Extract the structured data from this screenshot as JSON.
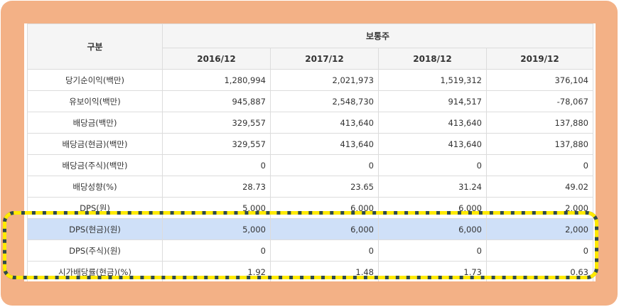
{
  "header": {
    "category_label": "구분",
    "group_label": "보통주",
    "years": [
      "2016/12",
      "2017/12",
      "2018/12",
      "2019/12"
    ]
  },
  "rows": [
    {
      "label": "당기순이익(백만)",
      "values": [
        "1,280,994",
        "2,021,973",
        "1,519,312",
        "376,104"
      ]
    },
    {
      "label": "유보이익(백만)",
      "values": [
        "945,887",
        "2,548,730",
        "914,517",
        "-78,067"
      ]
    },
    {
      "label": "배당금(백만)",
      "values": [
        "329,557",
        "413,640",
        "413,640",
        "137,880"
      ]
    },
    {
      "label": "배당금(현금)(백만)",
      "values": [
        "329,557",
        "413,640",
        "413,640",
        "137,880"
      ]
    },
    {
      "label": "배당금(주식)(백만)",
      "values": [
        "0",
        "0",
        "0",
        "0"
      ]
    },
    {
      "label": "배당성향(%)",
      "values": [
        "28.73",
        "23.65",
        "31.24",
        "49.02"
      ]
    },
    {
      "label": "DPS(원)",
      "values": [
        "5,000",
        "6,000",
        "6,000",
        "2,000"
      ]
    },
    {
      "label": "DPS(현금)(원)",
      "values": [
        "5,000",
        "6,000",
        "6,000",
        "2,000"
      ]
    },
    {
      "label": "DPS(주식)(원)",
      "values": [
        "0",
        "0",
        "0",
        "0"
      ]
    },
    {
      "label": "시가배당률(현금)(%)",
      "values": [
        "1.92",
        "1.48",
        "1.73",
        "0.63"
      ]
    }
  ],
  "colors": {
    "frame": "#f3b186",
    "highlight_row": "#cfe0f8",
    "dash": "#ffea00",
    "dash_outline": "#2f4a4a"
  }
}
